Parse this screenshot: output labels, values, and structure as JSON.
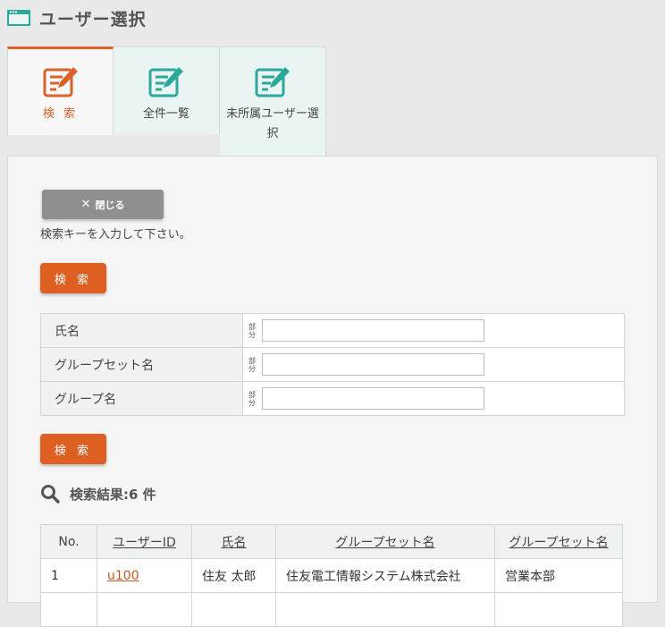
{
  "header": {
    "title": "ユーザー選択",
    "icon": "window-icon"
  },
  "tabs": [
    {
      "label": "検 索",
      "icon": "edit-icon",
      "active": true
    },
    {
      "label": "全件一覧",
      "icon": "edit-icon",
      "active": false
    },
    {
      "label": "未所属ユーザー選択",
      "icon": "edit-icon",
      "active": false
    }
  ],
  "close_button": {
    "label": "閉じる",
    "icon": "close-icon"
  },
  "instruction": "検索キーを入力して下さい。",
  "search_button_label": "検 索",
  "form": {
    "rows": [
      {
        "label": "氏名",
        "match": "部分",
        "value": ""
      },
      {
        "label": "グループセット名",
        "match": "部分",
        "value": ""
      },
      {
        "label": "グループ名",
        "match": "部分",
        "value": ""
      }
    ]
  },
  "results": {
    "heading": "検索結果:6 件",
    "columns": [
      "No.",
      "ユーザーID",
      "氏名",
      "グループセット名",
      "グループセット名"
    ],
    "rows": [
      [
        "1",
        "u100",
        "住友 太郎",
        "住友電工情報システム株式会社",
        "営業本部"
      ],
      [
        "",
        "",
        "",
        "",
        ""
      ]
    ]
  },
  "colors": {
    "accent": "#dd5f22",
    "teal": "#2aa89a",
    "tab_bg": "#eaf4f2"
  }
}
